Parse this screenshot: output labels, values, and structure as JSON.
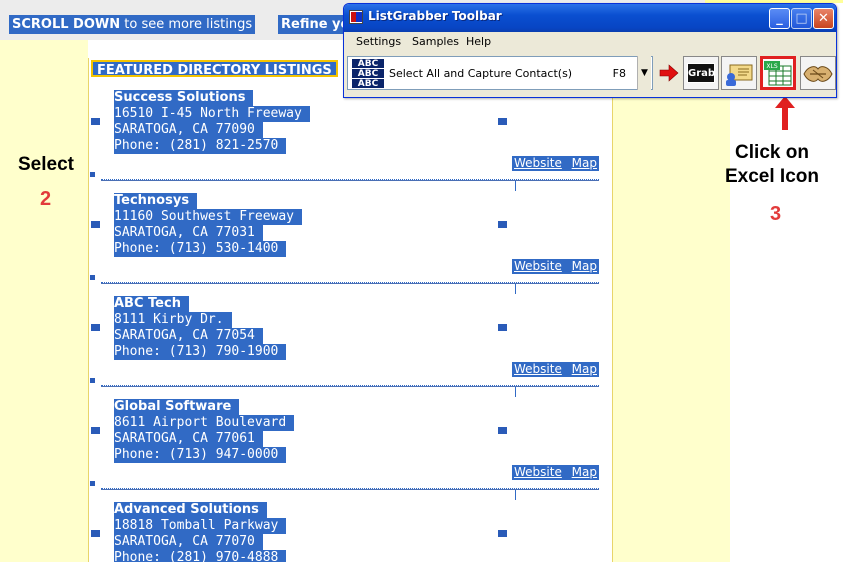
{
  "top_bar": {
    "scroll_bold": "SCROLL DOWN",
    "scroll_rest": " to see more listings",
    "refine": "Refine yo"
  },
  "listings": {
    "header": "FEATURED DIRECTORY LISTINGS",
    "items": [
      {
        "name": "Success Solutions",
        "street": "16510 I-45 North Freeway",
        "city": "SARATOGA, CA 77090",
        "phone": "Phone: (281) 821-2570",
        "website": "Website",
        "map": "Map"
      },
      {
        "name": "Technosys",
        "street": "11160 Southwest Freeway",
        "city": "SARATOGA, CA 77031",
        "phone": "Phone: (713) 530-1400",
        "website": "Website",
        "map": "Map"
      },
      {
        "name": "ABC Tech",
        "street": "8111 Kirby Dr.",
        "city": "SARATOGA, CA 77054",
        "phone": "Phone: (713) 790-1900",
        "website": "Website",
        "map": "Map"
      },
      {
        "name": "Global Software",
        "street": "8611 Airport Boulevard",
        "city": "SARATOGA, CA 77061",
        "phone": "Phone: (713) 947-0000",
        "website": "Website",
        "map": "Map"
      },
      {
        "name": "Advanced Solutions",
        "street": "18818 Tomball Parkway",
        "city": "SARATOGA, CA 77070",
        "phone": "Phone: (281) 970-4888",
        "website": "",
        "map": ""
      }
    ]
  },
  "instructions": {
    "select_label": "Select",
    "select_step": "2",
    "excel_label_line1": "Click on",
    "excel_label_line2": "Excel Icon",
    "excel_step": "3"
  },
  "toolbar_window": {
    "title": "ListGrabber Toolbar",
    "menu": [
      "Settings",
      "Samples",
      "Help"
    ],
    "action_icon_text": "ABC",
    "action_label": "Select All and Capture Contact(s)",
    "action_shortcut": "F8",
    "grab_label": "Grab",
    "excel_label": "XLS",
    "title_buttons": {
      "minimize": "_",
      "maximize": "□",
      "close": "✕"
    },
    "icons": [
      "app-icon",
      "abc-capture-icon",
      "dropdown-arrow-icon",
      "run-arrow-icon",
      "grab-icon",
      "contact-card-icon",
      "excel-icon",
      "handshake-icon"
    ]
  },
  "colors": {
    "selection": "#316ac5",
    "highlight_red": "#e02020",
    "step_red": "#e23b3b",
    "page_yellow": "#ffffcc",
    "titlebar_blue": "#0a4fd0"
  }
}
